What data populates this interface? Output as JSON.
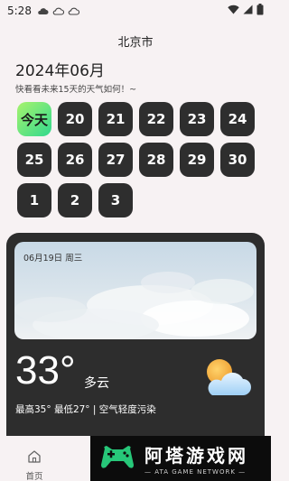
{
  "status_bar": {
    "time": "5:28"
  },
  "header": {
    "city": "北京市",
    "month_title": "2024年06月",
    "subtitle": "快看看未来15天的天气如何！~"
  },
  "days": [
    {
      "label": "今天",
      "is_today": true
    },
    {
      "label": "20"
    },
    {
      "label": "21"
    },
    {
      "label": "22"
    },
    {
      "label": "23"
    },
    {
      "label": "24"
    },
    {
      "label": "25"
    },
    {
      "label": "26"
    },
    {
      "label": "27"
    },
    {
      "label": "28"
    },
    {
      "label": "29"
    },
    {
      "label": "30"
    },
    {
      "label": "1"
    },
    {
      "label": "2"
    },
    {
      "label": "3"
    }
  ],
  "weather": {
    "date_label": "06月19日 周三",
    "temperature": "33°",
    "condition": "多云",
    "details": "最高35° 最低27° | 空气轻度污染",
    "icon": "partly-cloudy-icon"
  },
  "tab_bar": {
    "home_label": "首页",
    "home_icon": "home-icon"
  },
  "watermark": {
    "cn": "阿塔游戏网",
    "en": "— ATA GAME NETWORK —"
  },
  "colors": {
    "background": "#f7f2f3",
    "day_tile": "#2e2e2e",
    "today_gradient_start": "#a7f36d",
    "today_gradient_end": "#31d98e",
    "card": "#2d2d2d"
  }
}
